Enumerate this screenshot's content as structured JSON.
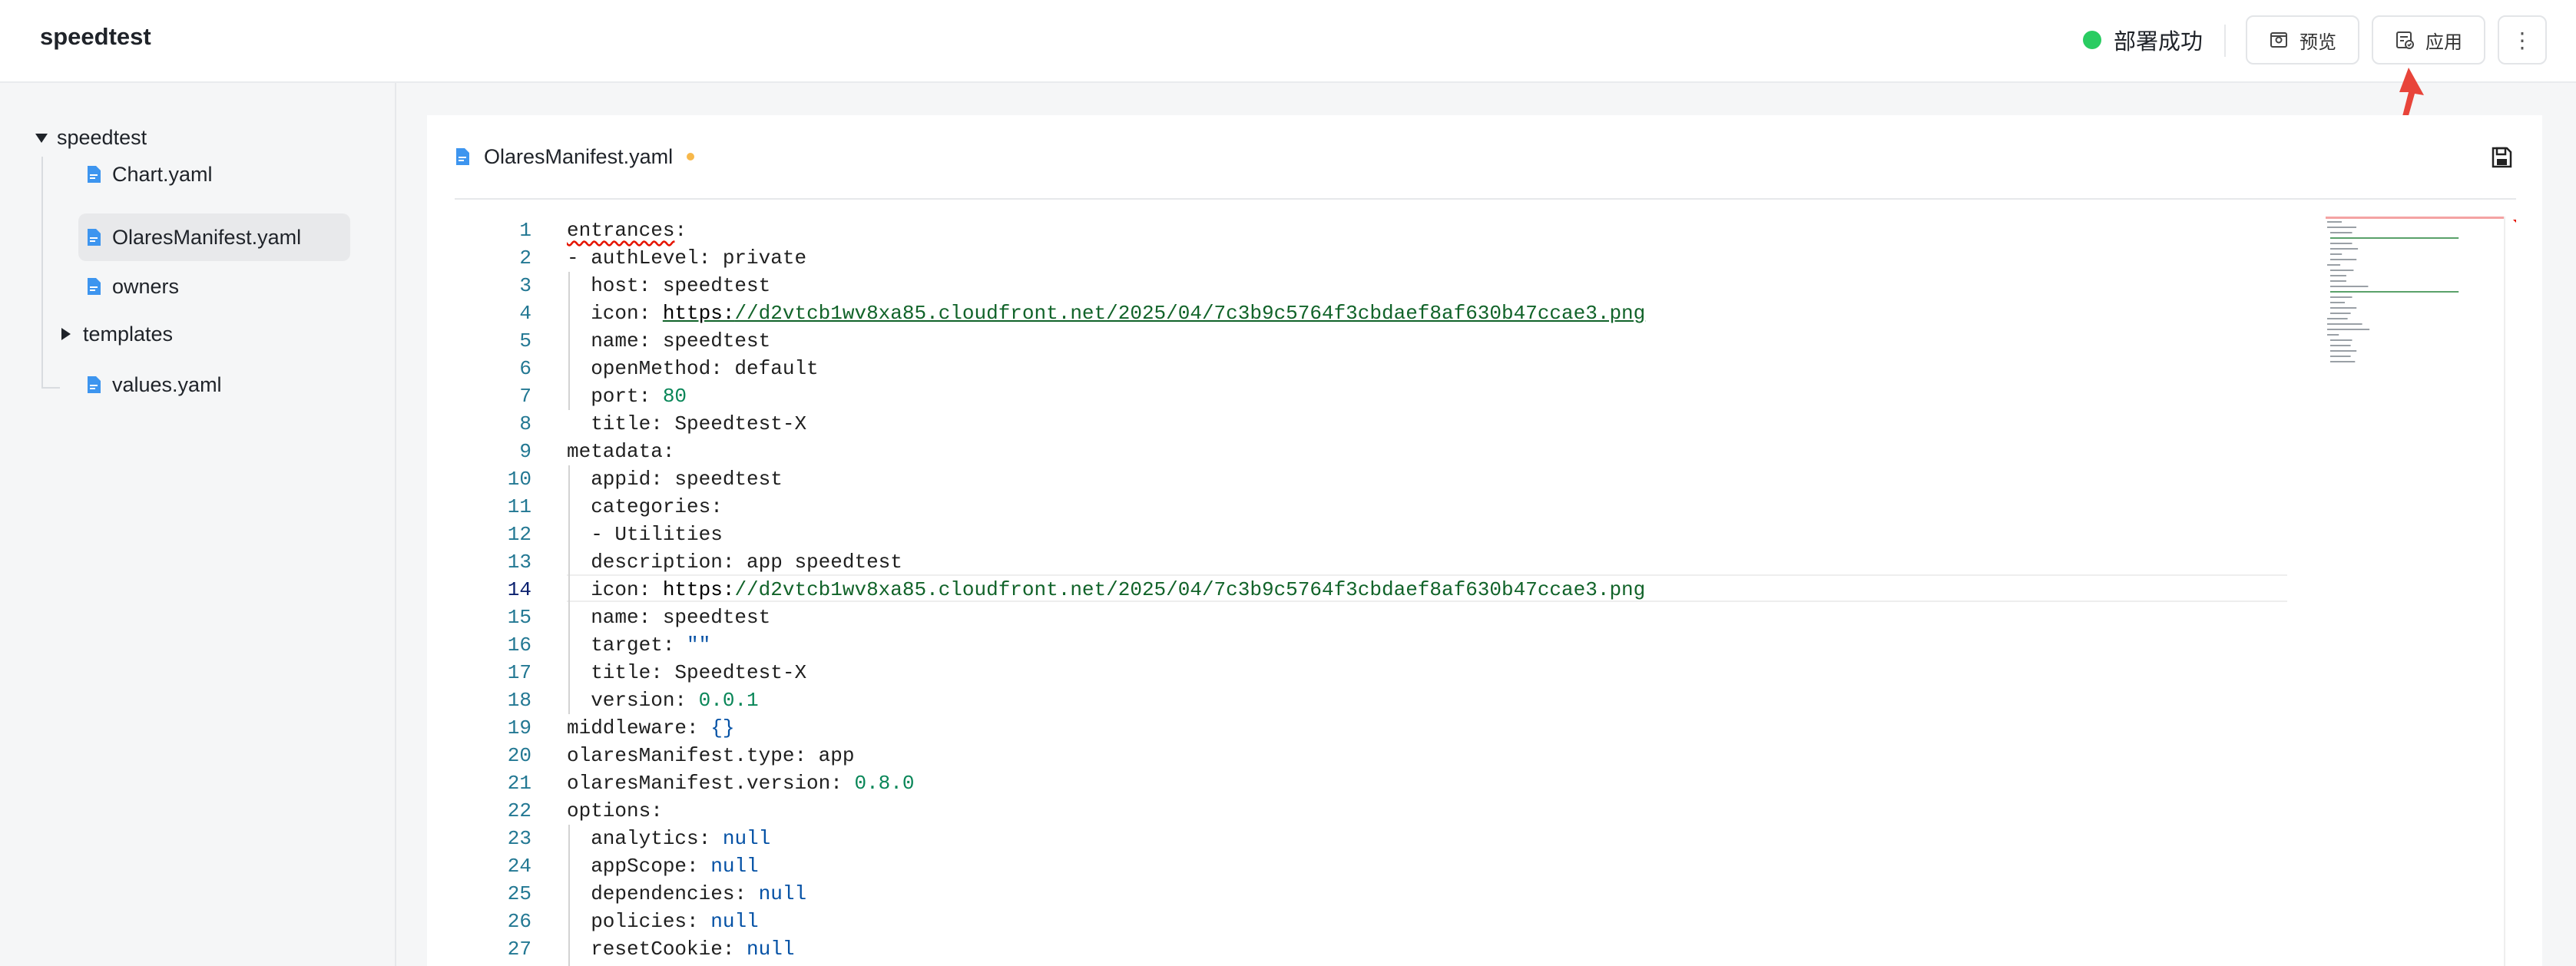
{
  "header": {
    "app_title": "speedtest",
    "deploy_status": "部署成功",
    "status_color": "#29cc61",
    "preview_label": "预览",
    "apply_label": "应用",
    "more_label": "⋮",
    "icons": [
      "preview-icon",
      "apply-icon",
      "more-vertical-icon",
      "red-arrow-annotation"
    ]
  },
  "sidebar": {
    "root": "speedtest",
    "items": [
      {
        "label": "Chart.yaml",
        "type": "file"
      },
      {
        "label": "OlaresManifest.yaml",
        "type": "file",
        "selected": true
      },
      {
        "label": "owners",
        "type": "file"
      },
      {
        "label": "templates",
        "type": "folder"
      },
      {
        "label": "values.yaml",
        "type": "file"
      }
    ]
  },
  "editor": {
    "file_name": "OlaresManifest.yaml",
    "modified": true,
    "active_line": 14,
    "accent_color": "#2f8ef7",
    "lines": [
      {
        "n": "1",
        "t": "entrances:"
      },
      {
        "n": "2",
        "t": "- authLevel: private"
      },
      {
        "n": "3",
        "t": "  host: speedtest"
      },
      {
        "n": "4",
        "t": "  icon: https://d2vtcb1wv8xa85.cloudfront.net/2025/04/7c3b9c5764f3cbdaef8af630b47ccae3.png"
      },
      {
        "n": "5",
        "t": "  name: speedtest"
      },
      {
        "n": "6",
        "t": "  openMethod: default"
      },
      {
        "n": "7",
        "t": "  port: 80"
      },
      {
        "n": "8",
        "t": "  title: Speedtest-X"
      },
      {
        "n": "9",
        "t": "metadata:"
      },
      {
        "n": "10",
        "t": "  appid: speedtest"
      },
      {
        "n": "11",
        "t": "  categories:"
      },
      {
        "n": "12",
        "t": "  - Utilities"
      },
      {
        "n": "13",
        "t": "  description: app speedtest"
      },
      {
        "n": "14",
        "t": "  icon: https://d2vtcb1wv8xa85.cloudfront.net/2025/04/7c3b9c5764f3cbdaef8af630b47ccae3.png"
      },
      {
        "n": "15",
        "t": "  name: speedtest"
      },
      {
        "n": "16",
        "t": "  target: \"\""
      },
      {
        "n": "17",
        "t": "  title: Speedtest-X"
      },
      {
        "n": "18",
        "t": "  version: 0.0.1"
      },
      {
        "n": "19",
        "t": "middleware: {}"
      },
      {
        "n": "20",
        "t": "olaresManifest.type: app"
      },
      {
        "n": "21",
        "t": "olaresManifest.version: 0.8.0"
      },
      {
        "n": "22",
        "t": "options:"
      },
      {
        "n": "23",
        "t": "  analytics: null"
      },
      {
        "n": "24",
        "t": "  appScope: null"
      },
      {
        "n": "25",
        "t": "  dependencies: null"
      },
      {
        "n": "26",
        "t": "  policies: null"
      },
      {
        "n": "27",
        "t": "  resetCookie: null"
      }
    ]
  }
}
